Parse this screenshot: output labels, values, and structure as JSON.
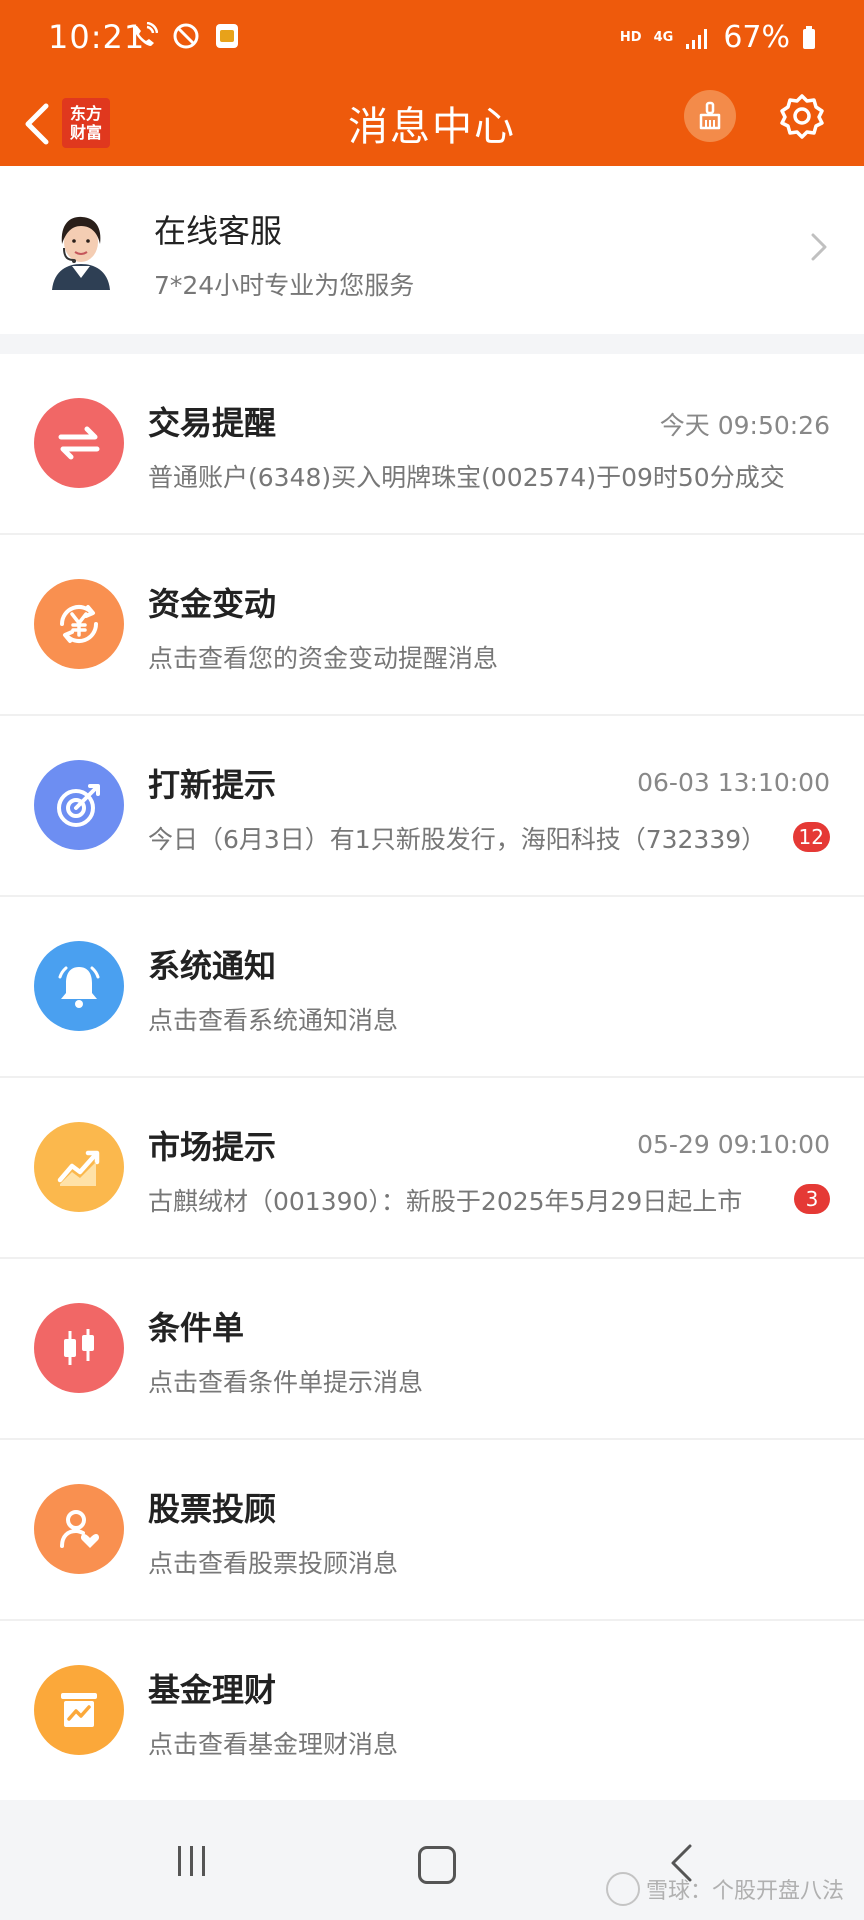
{
  "status_bar": {
    "time": "10:21",
    "network_hd": "HD",
    "network_type": "4G",
    "battery": "67%"
  },
  "header": {
    "logo_line1": "东方",
    "logo_line2": "财富",
    "title": "消息中心"
  },
  "customer_service": {
    "title": "在线客服",
    "subtitle": "7*24小时专业为您服务"
  },
  "messages": [
    {
      "title": "交易提醒",
      "time": "今天 09:50:26",
      "preview": "普通账户(6348)买入明牌珠宝(002574)于09时50分成交",
      "badge": "",
      "icon": "exchange-arrows-icon",
      "color": "#f16766"
    },
    {
      "title": "资金变动",
      "time": "",
      "preview": "点击查看您的资金变动提醒消息",
      "badge": "",
      "icon": "yuan-cycle-icon",
      "color": "#f99050"
    },
    {
      "title": "打新提示",
      "time": "06-03 13:10:00",
      "preview": "今日（6月3日）有1只新股发行，海阳科技（732339）",
      "badge": "12",
      "icon": "target-icon",
      "color": "#6d8ef2"
    },
    {
      "title": "系统通知",
      "time": "",
      "preview": "点击查看系统通知消息",
      "badge": "",
      "icon": "bell-icon",
      "color": "#4aa0f0"
    },
    {
      "title": "市场提示",
      "time": "05-29 09:10:00",
      "preview": "古麒绒材（001390）：新股于2025年5月29日起上市",
      "badge": "3",
      "icon": "trend-chart-icon",
      "color": "#fbb84d"
    },
    {
      "title": "条件单",
      "time": "",
      "preview": "点击查看条件单提示消息",
      "badge": "",
      "icon": "candlestick-icon",
      "color": "#f16766"
    },
    {
      "title": "股票投顾",
      "time": "",
      "preview": "点击查看股票投顾消息",
      "badge": "",
      "icon": "advisor-icon",
      "color": "#f99050"
    },
    {
      "title": "基金理财",
      "time": "",
      "preview": "点击查看基金理财消息",
      "badge": "",
      "icon": "fund-chart-icon",
      "color": "#fba83a"
    }
  ],
  "watermark": "雪球：个股开盘八法"
}
